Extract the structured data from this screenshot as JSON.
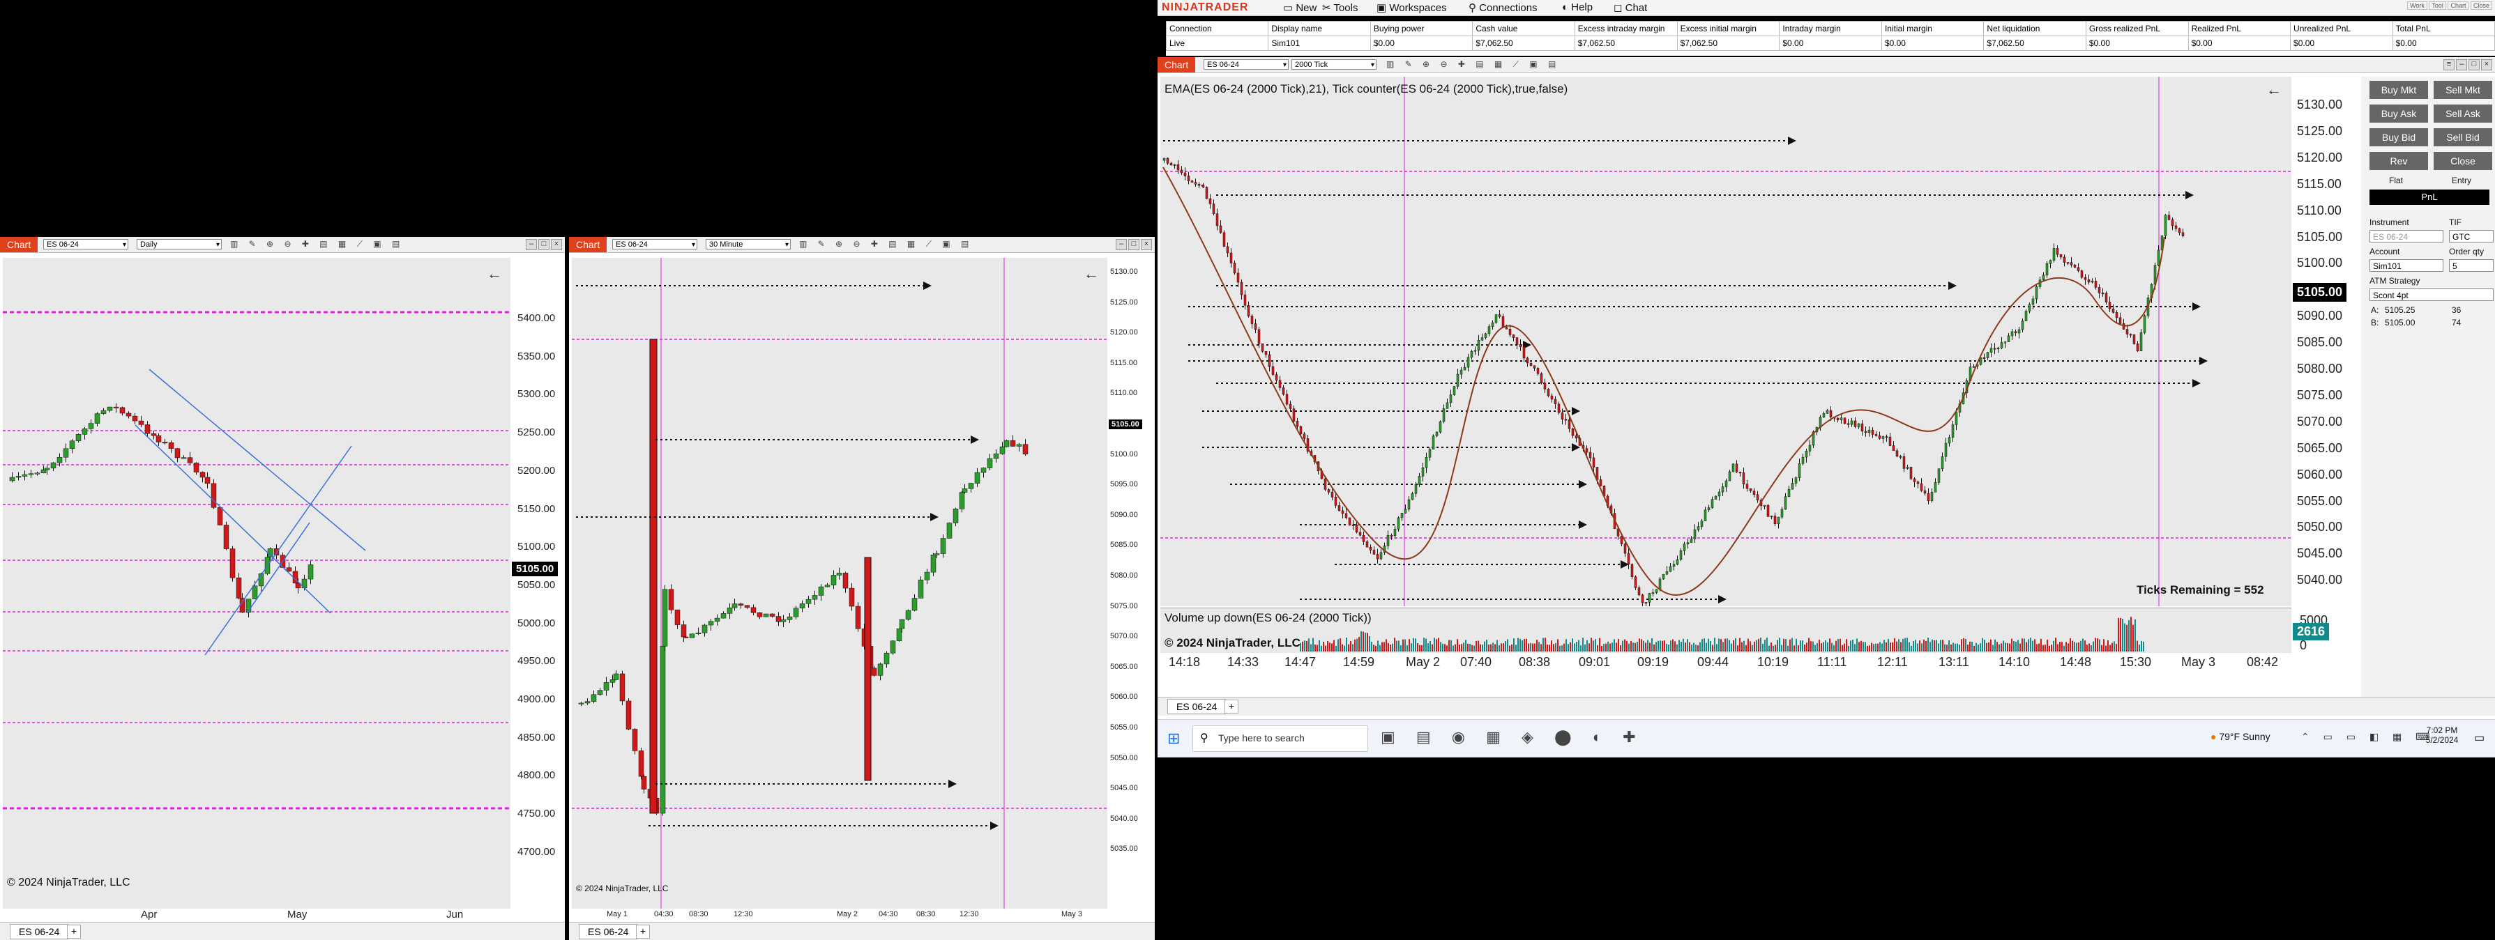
{
  "app": {
    "brand": "NINJATRADER",
    "menu": [
      "New",
      "Tools",
      "Workspaces",
      "Connections",
      "Help",
      "Chat"
    ],
    "mini_buttons": [
      "Work",
      "Tool",
      "Chart",
      "Close"
    ]
  },
  "account_table": {
    "headers": [
      "Connection",
      "Display name",
      "Buying power",
      "Cash value",
      "Excess intraday margin",
      "Excess initial margin",
      "Intraday margin",
      "Initial margin",
      "Net liquidation",
      "Gross realized PnL",
      "Realized PnL",
      "Unrealized PnL",
      "Total PnL"
    ],
    "row": [
      "Live",
      "Sim101",
      "$0.00",
      "$7,062.50",
      "$7,062.50",
      "$7,062.50",
      "$0.00",
      "$0.00",
      "$7,062.50",
      "$0.00",
      "$0.00",
      "$0.00",
      "$0.00"
    ]
  },
  "chart1": {
    "tag": "Chart",
    "instrument": "ES 06-24",
    "interval": "Daily",
    "y_ticks": [
      "5400.00",
      "5350.00",
      "5300.00",
      "5250.00",
      "5200.00",
      "5150.00",
      "5100.00",
      "5050.00",
      "5000.00",
      "4950.00",
      "4900.00",
      "4850.00",
      "4800.00",
      "4750.00",
      "4700.00"
    ],
    "x_ticks": [
      "Apr",
      "May",
      "Jun"
    ],
    "price_flag": "5105.00",
    "copyright": "© 2024 NinjaTrader, LLC",
    "tab": "ES 06-24"
  },
  "chart2": {
    "tag": "Chart",
    "instrument": "ES 06-24",
    "interval": "30 Minute",
    "y_ticks": [
      "5130.00",
      "5125.00",
      "5120.00",
      "5115.00",
      "5110.00",
      "5105.00",
      "5100.00",
      "5095.00",
      "5090.00",
      "5085.00",
      "5080.00",
      "5075.00",
      "5070.00",
      "5065.00",
      "5060.00",
      "5055.00",
      "5050.00",
      "5045.00",
      "5040.00",
      "5035.00"
    ],
    "x_ticks": [
      "May 1",
      "04:30",
      "08:30",
      "12:30",
      "May 2",
      "04:30",
      "08:30",
      "12:30",
      "May 3"
    ],
    "price_flag": "5105.00",
    "copyright": "© 2024 NinjaTrader, LLC",
    "tab": "ES 06-24"
  },
  "chart3": {
    "tag": "Chart",
    "instrument": "ES 06-24",
    "interval": "2000 Tick",
    "indicator_label": "EMA(ES 06-24 (2000 Tick),21), Tick counter(ES 06-24 (2000 Tick),true,false)",
    "volume_label": "Volume up down(ES 06-24 (2000 Tick))",
    "y_ticks": [
      "5130.00",
      "5125.00",
      "5120.00",
      "5115.00",
      "5110.00",
      "5105.00",
      "5100.00",
      "5095.00",
      "5090.00",
      "5085.00",
      "5080.00",
      "5075.00",
      "5070.00",
      "5065.00",
      "5060.00",
      "5055.00",
      "5050.00",
      "5045.00",
      "5040.00"
    ],
    "x_ticks": [
      "14:18",
      "14:33",
      "14:47",
      "14:59",
      "May 2",
      "07:40",
      "08:38",
      "09:01",
      "09:19",
      "09:44",
      "10:19",
      "11:11",
      "12:11",
      "13:11",
      "14:10",
      "14:48",
      "15:30",
      "May 3",
      "08:42"
    ],
    "price_flag": "5105.00",
    "ticks_remaining": "Ticks Remaining = 552",
    "volume_ticks": [
      "5000",
      "0"
    ],
    "volume_flag": "2616",
    "copyright": "© 2024 NinjaTrader, LLC",
    "tab": "ES 06-24"
  },
  "order_panel": {
    "buttons": [
      "Buy Mkt",
      "Sell Mkt",
      "Buy Ask",
      "Sell Ask",
      "Buy Bid",
      "Sell Bid",
      "Rev",
      "Close"
    ],
    "flat": "Flat",
    "entry": "Entry",
    "pnl": "PnL",
    "instrument_label": "Instrument",
    "instrument_value": "ES 06-24",
    "tif_label": "TIF",
    "tif_value": "GTC",
    "account_label": "Account",
    "account_value": "Sim101",
    "qty_label": "Order qty",
    "qty_value": "5",
    "atm_label": "ATM Strategy",
    "atm_value": "Scont 4pt",
    "ask_label": "A:",
    "ask_price": "5105.25",
    "ask_size": "36",
    "bid_label": "B:",
    "bid_price": "5105.00",
    "bid_size": "74"
  },
  "taskbar": {
    "search_placeholder": "Type here to search",
    "weather": "79°F  Sunny",
    "time": "7:02 PM",
    "date": "5/2/2024"
  },
  "colors": {
    "ninja_orange": "#e0401c",
    "up_candle": "#2c9c2c",
    "down_candle": "#d01818",
    "magenta_line": "#e020e0",
    "ema": "#8b3a1a",
    "teal_flag": "#138a8a"
  }
}
